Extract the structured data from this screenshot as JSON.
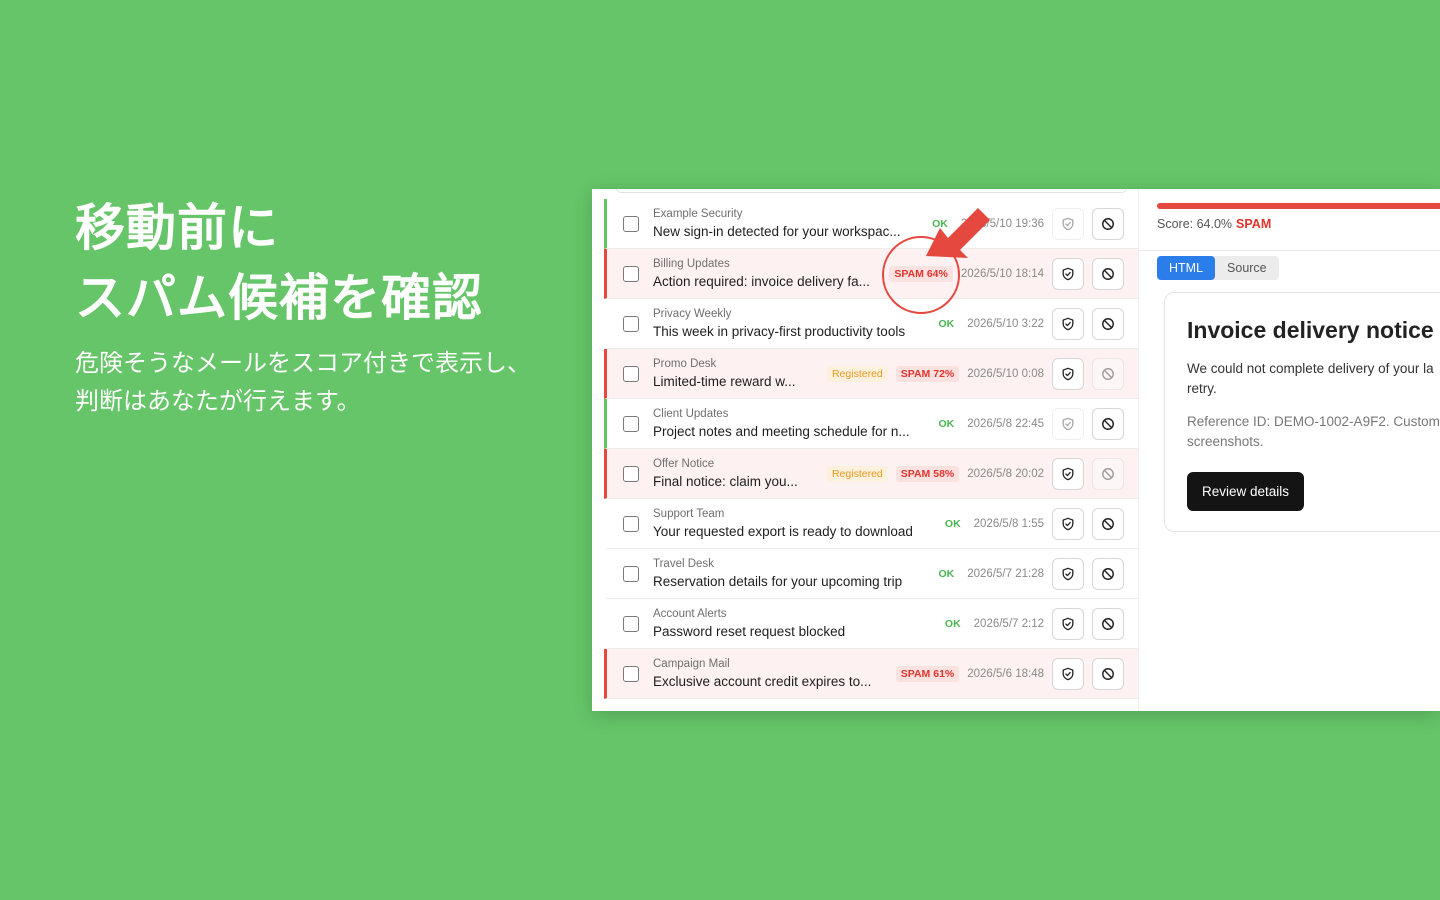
{
  "headline": {
    "line1": "移動前に",
    "line2": "スパム候補を確認"
  },
  "subline": {
    "line1": "危険そうなメールをスコア付きで表示し、",
    "line2": "判断はあなたが行えます。"
  },
  "colors": {
    "background": "#65c568",
    "spam": "#e0352d",
    "ok": "#4cb552",
    "registered": "#e99a1e",
    "accent": "#2b7de9"
  },
  "emails": [
    {
      "sender": "Example Security",
      "subject": "New sign-in detected for your workspac...",
      "status": "OK",
      "registered": "",
      "date": "2026/5/10 19:36",
      "spam": false,
      "border": "ok",
      "shield_faded": true,
      "block_faded": false
    },
    {
      "sender": "Billing Updates",
      "subject": "Action required: invoice delivery fa...",
      "status": "SPAM 64%",
      "registered": "",
      "date": "2026/5/10 18:14",
      "spam": true,
      "border": "spam",
      "shield_faded": false,
      "block_faded": false
    },
    {
      "sender": "Privacy Weekly",
      "subject": "This week in privacy-first productivity tools",
      "status": "OK",
      "registered": "",
      "date": "2026/5/10 3:22",
      "spam": false,
      "border": "none",
      "shield_faded": false,
      "block_faded": false
    },
    {
      "sender": "Promo Desk",
      "subject": "Limited-time reward w...",
      "status": "SPAM 72%",
      "registered": "Registered",
      "date": "2026/5/10 0:08",
      "spam": true,
      "border": "spam",
      "shield_faded": false,
      "block_faded": true
    },
    {
      "sender": "Client Updates",
      "subject": "Project notes and meeting schedule for n...",
      "status": "OK",
      "registered": "",
      "date": "2026/5/8 22:45",
      "spam": false,
      "border": "ok",
      "shield_faded": true,
      "block_faded": false
    },
    {
      "sender": "Offer Notice",
      "subject": "Final notice: claim you...",
      "status": "SPAM 58%",
      "registered": "Registered",
      "date": "2026/5/8 20:02",
      "spam": true,
      "border": "spam",
      "shield_faded": false,
      "block_faded": true
    },
    {
      "sender": "Support Team",
      "subject": "Your requested export is ready to download",
      "status": "OK",
      "registered": "",
      "date": "2026/5/8 1:55",
      "spam": false,
      "border": "none",
      "shield_faded": false,
      "block_faded": false
    },
    {
      "sender": "Travel Desk",
      "subject": "Reservation details for your upcoming trip",
      "status": "OK",
      "registered": "",
      "date": "2026/5/7 21:28",
      "spam": false,
      "border": "none",
      "shield_faded": false,
      "block_faded": false
    },
    {
      "sender": "Account Alerts",
      "subject": "Password reset request blocked",
      "status": "OK",
      "registered": "",
      "date": "2026/5/7 2:12",
      "spam": false,
      "border": "none",
      "shield_faded": false,
      "block_faded": false
    },
    {
      "sender": "Campaign Mail",
      "subject": "Exclusive account credit expires to...",
      "status": "SPAM 61%",
      "registered": "",
      "date": "2026/5/6 18:48",
      "spam": true,
      "border": "spam",
      "shield_faded": false,
      "block_faded": false
    }
  ],
  "detail": {
    "score_label": "Score: 64.0%",
    "score_verdict": "SPAM",
    "score_value": 0.64,
    "tabs": [
      {
        "label": "HTML",
        "active": true
      },
      {
        "label": "Source",
        "active": false
      }
    ],
    "card": {
      "title": "Invoice delivery notice",
      "body_line1": "We could not complete delivery of your la",
      "body_line2": "retry.",
      "ref_line1": "Reference ID: DEMO-1002-A9F2. Custom",
      "ref_line2": "screenshots.",
      "button_label": "Review details"
    }
  },
  "icons": {
    "shield": "shield-icon",
    "block": "block-icon",
    "annotation": "arrow-icon"
  }
}
